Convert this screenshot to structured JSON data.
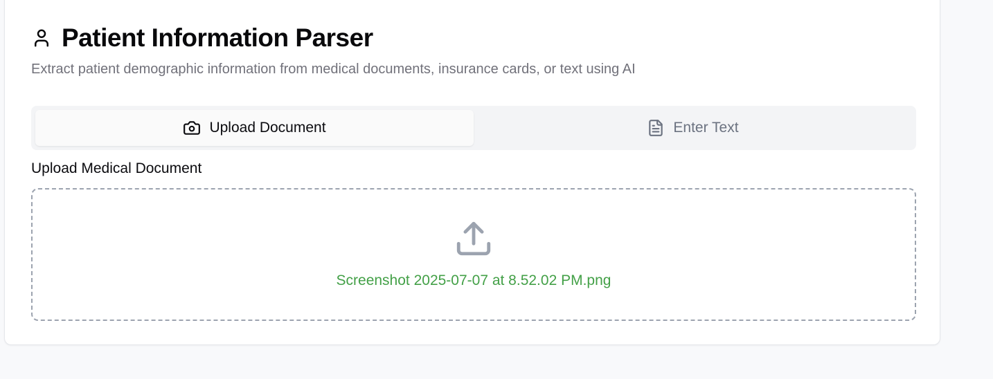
{
  "header": {
    "title": "Patient Information Parser",
    "subtitle": "Extract patient demographic information from medical documents, insurance cards, or text using AI",
    "icon": "user-icon"
  },
  "tabs": [
    {
      "label": "Upload Document",
      "icon": "camera-icon",
      "active": true
    },
    {
      "label": "Enter Text",
      "icon": "file-text-icon",
      "active": false
    }
  ],
  "upload": {
    "label": "Upload Medical Document",
    "icon": "upload-icon",
    "filename": "Screenshot 2025-07-07 at 8.52.02 PM.png"
  },
  "colors": {
    "filename": "#43a047",
    "muted": "#6b7280",
    "tab_bg": "#f3f4f6"
  }
}
